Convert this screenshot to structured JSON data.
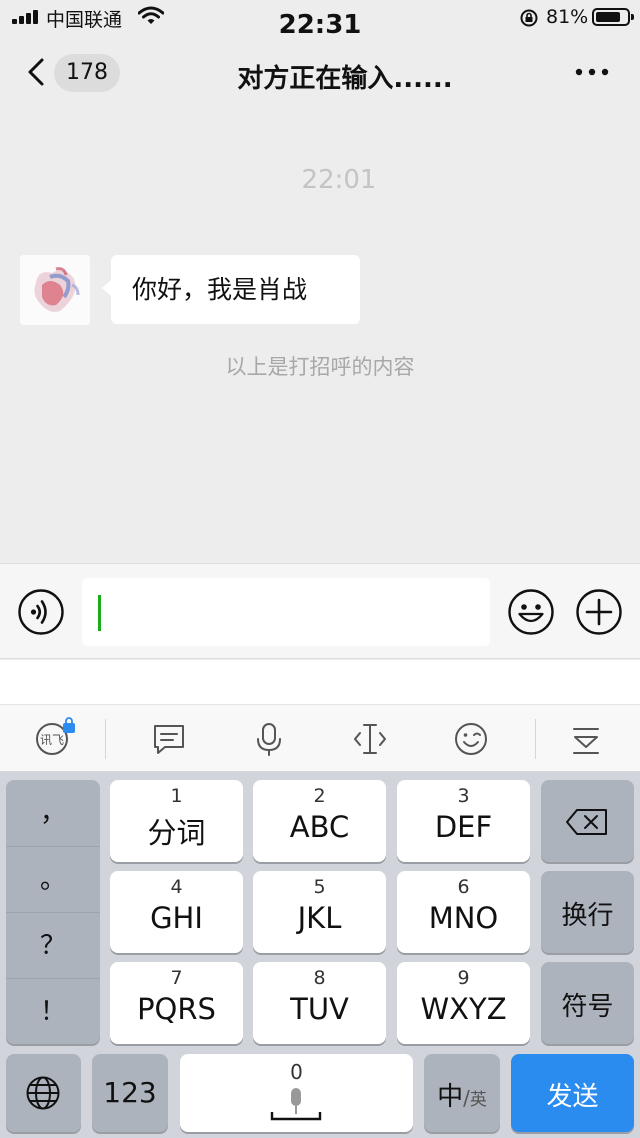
{
  "status_bar": {
    "carrier": "中国联通",
    "time": "22:31",
    "battery": "81%"
  },
  "nav": {
    "unread_count": "178",
    "title": "对方正在输入......"
  },
  "chat": {
    "timestamp": "22:01",
    "messages": [
      {
        "text": "你好，我是肖战"
      }
    ],
    "system_note": "以上是打招呼的内容"
  },
  "input_bar": {
    "value": "",
    "icons": [
      "voice-icon",
      "emoji-icon",
      "plus-icon"
    ]
  },
  "keyboard_toolbar": {
    "icons": [
      "ime-logo-icon",
      "message-icon",
      "microphone-icon",
      "cursor-icon",
      "smiley-icon",
      "collapse-keyboard-icon"
    ]
  },
  "keyboard": {
    "punctuation": [
      "，",
      "。",
      "？",
      "！"
    ],
    "keys": [
      {
        "num": "1",
        "label": "分词"
      },
      {
        "num": "2",
        "label": "ABC"
      },
      {
        "num": "3",
        "label": "DEF"
      },
      {
        "num": "4",
        "label": "GHI"
      },
      {
        "num": "5",
        "label": "JKL"
      },
      {
        "num": "6",
        "label": "MNO"
      },
      {
        "num": "7",
        "label": "PQRS"
      },
      {
        "num": "8",
        "label": "TUV"
      },
      {
        "num": "9",
        "label": "WXYZ"
      }
    ],
    "newline": "换行",
    "symbols": "符号",
    "numeric": "123",
    "space_num": "0",
    "lang_main": "中",
    "lang_sub": "英",
    "send": "发送"
  }
}
